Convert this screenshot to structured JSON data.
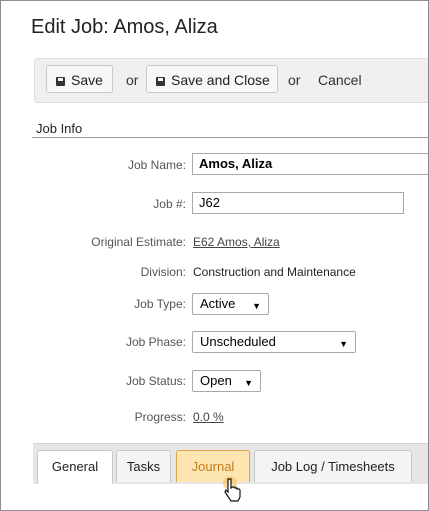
{
  "page": {
    "title": "Edit Job: Amos, Aliza"
  },
  "toolbar": {
    "save_label": "Save",
    "or1": "or",
    "save_close_label": "Save and Close",
    "or2": "or",
    "cancel_label": "Cancel"
  },
  "section": {
    "title": "Job Info"
  },
  "fields": {
    "job_name_label": "Job Name:",
    "job_name_value": "Amos, Aliza",
    "job_number_label": "Job #:",
    "job_number_value": "J62",
    "original_estimate_label": "Original Estimate:",
    "original_estimate_value": "E62 Amos, Aliza",
    "division_label": "Division:",
    "division_value": "Construction and Maintenance",
    "job_type_label": "Job Type:",
    "job_type_value": "Active",
    "job_phase_label": "Job Phase:",
    "job_phase_value": "Unscheduled",
    "job_status_label": "Job Status:",
    "job_status_value": "Open",
    "progress_label": "Progress:",
    "progress_value": "0.0 %"
  },
  "tabs": [
    {
      "label": "General"
    },
    {
      "label": "Tasks"
    },
    {
      "label": "Journal"
    },
    {
      "label": "Job Log / Timesheets"
    }
  ],
  "icons": {
    "save": "floppy-disk-icon",
    "cursor": "hand-pointer-icon"
  },
  "colors": {
    "tab_hover": "#fde6b2",
    "tab_hover_border": "#e3a74a"
  }
}
